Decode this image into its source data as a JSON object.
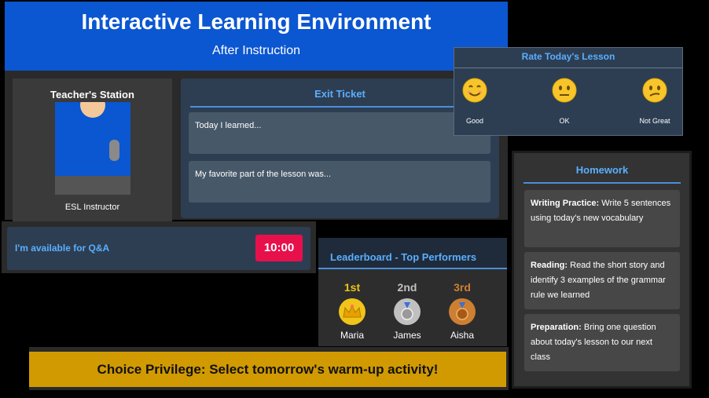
{
  "header": {
    "title": "Interactive Learning Environment",
    "subtitle": "After Instruction"
  },
  "teacher": {
    "title": "Teacher's Station",
    "caption": "ESL Instructor"
  },
  "exit_ticket": {
    "title": "Exit Ticket",
    "fields": [
      {
        "placeholder": "Today I learned..."
      },
      {
        "placeholder": "My favorite part of the lesson was..."
      }
    ]
  },
  "qa": {
    "text": "I'm available for Q&A",
    "timer": "10:00"
  },
  "leaderboard": {
    "title": "Leaderboard - Top Performers",
    "entries": [
      {
        "rank": "1st",
        "name": "Maria",
        "medal": "crown-icon",
        "color": "#f0c419"
      },
      {
        "rank": "2nd",
        "name": "James",
        "medal": "silver-medal-icon",
        "color": "#c0c0c0"
      },
      {
        "rank": "3rd",
        "name": "Aisha",
        "medal": "bronze-medal-icon",
        "color": "#cd7f32"
      }
    ]
  },
  "choice": {
    "text": "Choice Privilege: Select tomorrow's warm-up activity!"
  },
  "rating": {
    "title": "Rate Today's Lesson",
    "options": [
      {
        "label": "Good",
        "icon": "smiling-face-icon"
      },
      {
        "label": "OK",
        "icon": "neutral-face-icon"
      },
      {
        "label": "Not Great",
        "icon": "confused-face-icon"
      }
    ]
  },
  "homework": {
    "title": "Homework",
    "items": [
      {
        "label": "Writing Practice:",
        "text": "Write 5 sentences using today's new vocabulary"
      },
      {
        "label": "Reading:",
        "text": "Read the short story and identify 3 examples of the grammar rule we learned"
      },
      {
        "label": "Preparation:",
        "text": "Bring one question about today's lesson to our next class"
      }
    ]
  },
  "colors": {
    "header_blue": "#0b56d1",
    "accent_blue": "#5aaeff",
    "timer_red": "#e8104b",
    "choice_gold": "#d19a00",
    "panel_slate": "#2d3e52"
  }
}
